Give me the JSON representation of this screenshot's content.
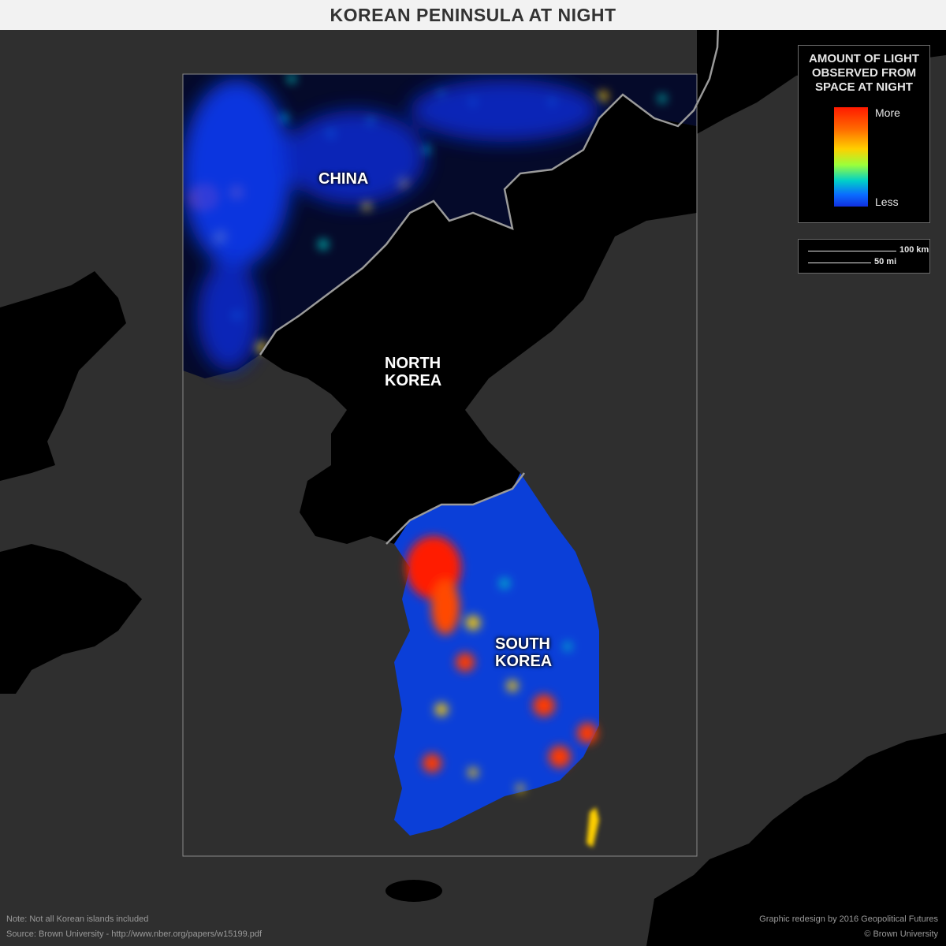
{
  "title": "KOREAN PENINSULA AT NIGHT",
  "legend": {
    "title_lines": [
      "AMOUNT OF LIGHT",
      "OBSERVED FROM",
      "SPACE AT NIGHT"
    ],
    "more": "More",
    "less": "Less",
    "gradient_colors": [
      "#ff1a00",
      "#ff6a00",
      "#ffd000",
      "#9cff3a",
      "#00d0c8",
      "#0a6cff",
      "#1030e0"
    ]
  },
  "scale": {
    "km": "100 km",
    "mi": "50 mi"
  },
  "labels": {
    "china": "CHINA",
    "north_korea": [
      "NORTH",
      "KOREA"
    ],
    "south_korea": [
      "SOUTH",
      "KOREA"
    ]
  },
  "footer": {
    "note": "Note: Not all Korean islands included",
    "source": "Source: Brown University - http://www.nber.org/papers/w15199.pdf",
    "credit": "Graphic redesign by 2016 Geopolitical Futures",
    "copyright": "© Brown University"
  },
  "colors": {
    "background": "#2f2f2f",
    "land_dark": "#000000",
    "title_bar": "#f2f2f2",
    "title_text": "#333333",
    "light_low": "#1030e0",
    "light_high": "#ff1a00",
    "border": "#a0a0a0"
  }
}
